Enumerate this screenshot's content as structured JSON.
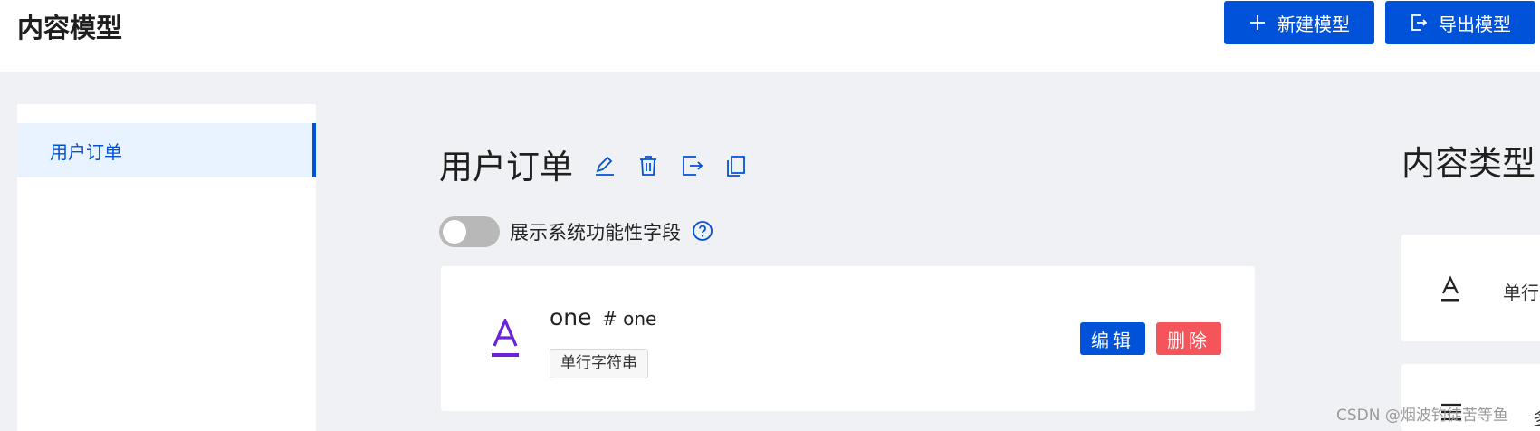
{
  "header": {
    "title": "内容模型",
    "new_model_label": "新建模型",
    "export_model_label": "导出模型",
    "accent": "#0052d9"
  },
  "sidebar": {
    "items": [
      {
        "label": "用户订单",
        "active": true
      }
    ]
  },
  "main": {
    "model_title": "用户订单",
    "toolbar_icons": [
      "edit-icon",
      "delete-icon",
      "export-icon",
      "copy-icon"
    ],
    "toggle": {
      "label": "展示系统功能性字段",
      "on": false
    },
    "fields": [
      {
        "name": "one",
        "key": "# one",
        "type_tag": "单行字符串",
        "icon": "text-icon",
        "edit_label": "编辑",
        "delete_label": "删除"
      }
    ]
  },
  "types_panel": {
    "title": "内容类型",
    "items": [
      {
        "label": "单行",
        "icon": "text-icon"
      },
      {
        "label": "多行",
        "icon": "multiline-icon"
      }
    ]
  },
  "watermark": "CSDN @烟波钓徒苦等鱼"
}
